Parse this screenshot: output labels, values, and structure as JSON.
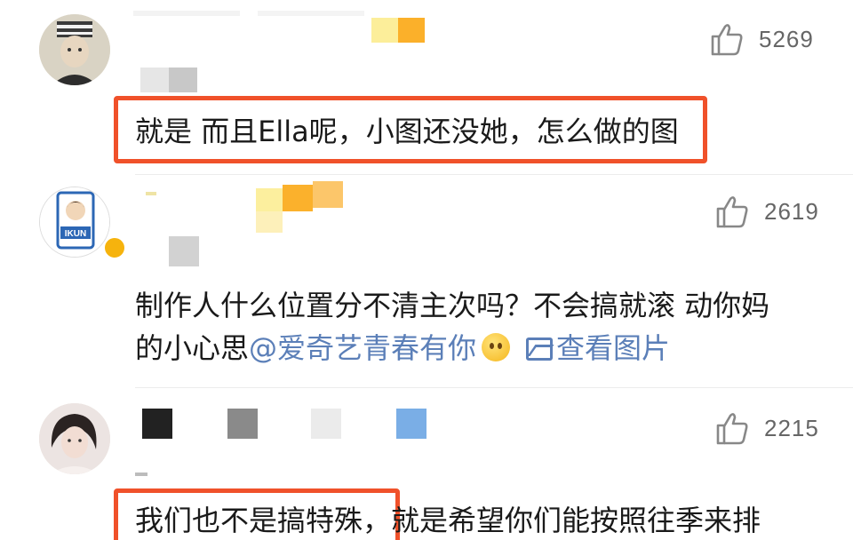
{
  "comments": [
    {
      "likes": "5269",
      "text": "就是 而且Ella呢，小图还没她，怎么做的图"
    },
    {
      "likes": "2619",
      "avatar_label": "IKUN",
      "line1": "制作人什么位置分不清主次吗？不会搞就滚 动你妈",
      "line2_prefix": "的小心思",
      "mention": "@爱奇艺青春有你",
      "image_link": "查看图片"
    },
    {
      "likes": "2215",
      "text_boxed": "我们也不是搞特殊，",
      "text_rest": "就是希望你们能按照往季来排"
    }
  ],
  "colors": {
    "highlight_box": "#f0512a",
    "link": "#5b7fb8",
    "like_count": "#666666"
  },
  "icons": [
    "thumbs-up-icon",
    "smiley-emoji-icon",
    "image-icon",
    "verified-badge-icon"
  ]
}
